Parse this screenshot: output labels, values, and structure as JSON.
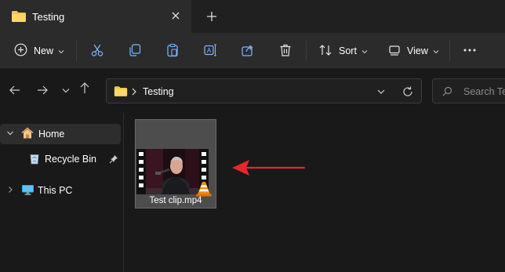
{
  "window": {
    "tab_title": "Testing",
    "icons": {
      "tab_folder": "folder-icon",
      "close": "close-icon",
      "new_tab": "plus-icon"
    }
  },
  "command_bar": {
    "new_label": "New",
    "sort_label": "Sort",
    "view_label": "View",
    "icons": [
      "plus-circle-icon",
      "cut-icon",
      "copy-icon",
      "paste-icon",
      "rename-icon",
      "share-icon",
      "delete-icon",
      "sort-icon",
      "view-icon",
      "more-icon"
    ]
  },
  "address_bar": {
    "path": [
      "Testing"
    ],
    "search_placeholder": "Search Testing"
  },
  "nav_pane": {
    "items": [
      {
        "label": "Home",
        "icon": "home-icon",
        "expanded": true,
        "selected": true
      },
      {
        "label": "Recycle Bin",
        "icon": "recycle-bin-icon",
        "pinned": true
      },
      {
        "label": "This PC",
        "icon": "pc-icon",
        "expanded": false
      }
    ]
  },
  "files": [
    {
      "name": "Test clip.mp4",
      "type": "video",
      "app_icon": "vlc-cone-icon",
      "selected": true
    }
  ],
  "annotation": {
    "icon": "red-arrow-icon",
    "color": "#e8262b"
  },
  "colors": {
    "accent": "#ffc83d",
    "selection": "#4d4d4d"
  }
}
